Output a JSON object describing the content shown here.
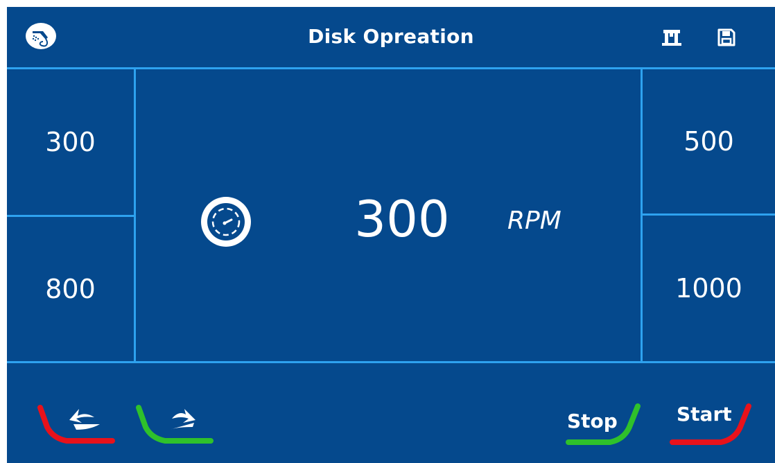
{
  "header": {
    "title": "Disk Opreation",
    "icons": [
      "shower-head-icon",
      "device-icon",
      "save-icon"
    ]
  },
  "presets": {
    "top_left": "300",
    "bottom_left": "800",
    "top_right": "500",
    "bottom_right": "1000"
  },
  "speed": {
    "icon": "speedometer-icon",
    "value": "300",
    "unit": "RPM"
  },
  "footer": {
    "back_icon": "back-arrow-icon",
    "forward_icon": "forward-arrow-icon",
    "stop_label": "Stop",
    "start_label": "Start"
  },
  "colors": {
    "background": "#05498d",
    "grid_lines": "#2ea2ef",
    "red": "#e8121b",
    "green": "#2fc12b"
  }
}
